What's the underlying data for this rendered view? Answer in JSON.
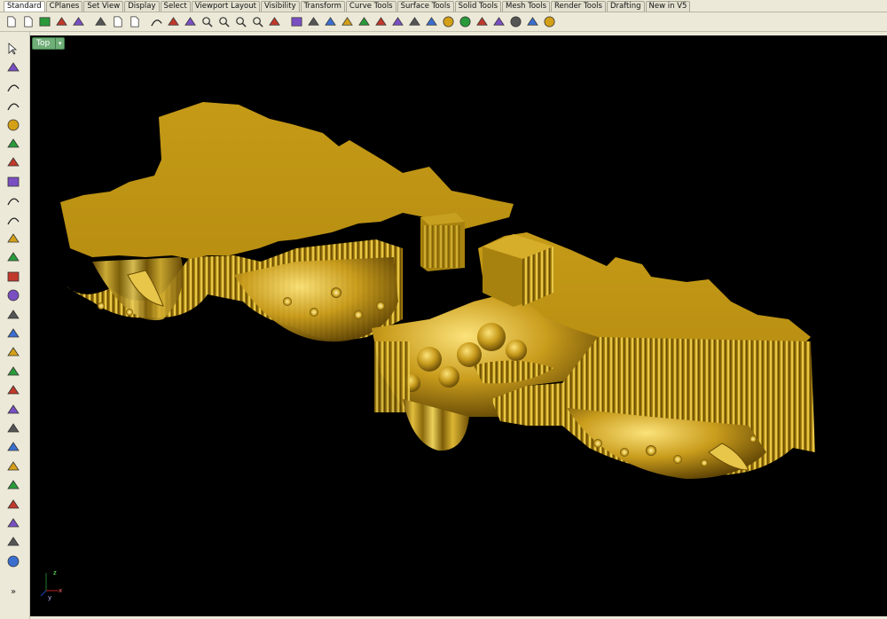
{
  "tabs": [
    "Standard",
    "CPlanes",
    "Set View",
    "Display",
    "Select",
    "Viewport Layout",
    "Visibility",
    "Transform",
    "Curve Tools",
    "Surface Tools",
    "Solid Tools",
    "Mesh Tools",
    "Render Tools",
    "Drafting",
    "New in V5"
  ],
  "viewport": {
    "label": "Top",
    "axis_labels": {
      "x": "x",
      "y": "y",
      "z": "z"
    }
  },
  "left_toolbar": {
    "overflow": "»"
  },
  "colors": {
    "viewport_bg": "#000000",
    "model": "#c9a21f",
    "model_highlight": "#e9c845",
    "model_shadow": "#7a5a08",
    "ui_bg": "#ece9d8",
    "viewport_label_bg": "#6fae77"
  },
  "toolbar_icons": [
    "new-file-icon",
    "open-file-icon",
    "save-icon",
    "print-icon",
    "import-icon",
    "cut-icon",
    "copy-icon",
    "paste-icon",
    "undo-icon",
    "pan-icon",
    "move-icon",
    "zoom-dynamic-icon",
    "zoom-window-icon",
    "zoom-extents-icon",
    "zoom-selected-icon",
    "rotate-view-icon",
    "four-viewports-icon",
    "named-views-icon",
    "cplane-icon",
    "set-cplane-icon",
    "osnap-icon",
    "hide-icon",
    "lights-icon",
    "layers-icon",
    "object-properties-icon",
    "render-color-icon",
    "render-icon",
    "material-icon",
    "wireframe-icon",
    "shaded-icon",
    "options-icon",
    "help-icon"
  ],
  "left_icons": [
    "select-arrow-icon",
    "point-icon",
    "polyline-icon",
    "curve-icon",
    "circle-icon",
    "ellipse-icon",
    "polygon-icon",
    "rectangle-icon",
    "arc-icon",
    "fillet-curve-icon",
    "surface-icon",
    "extrude-surface-icon",
    "box-icon",
    "sphere-icon",
    "cylinder-icon",
    "mesh-icon",
    "boolean-icon",
    "split-icon",
    "trim-icon",
    "join-icon",
    "explode-icon",
    "move-object-icon",
    "rotate-object-icon",
    "text-icon",
    "dimension-icon",
    "array-icon",
    "analyze-icon",
    "render-object-icon"
  ]
}
